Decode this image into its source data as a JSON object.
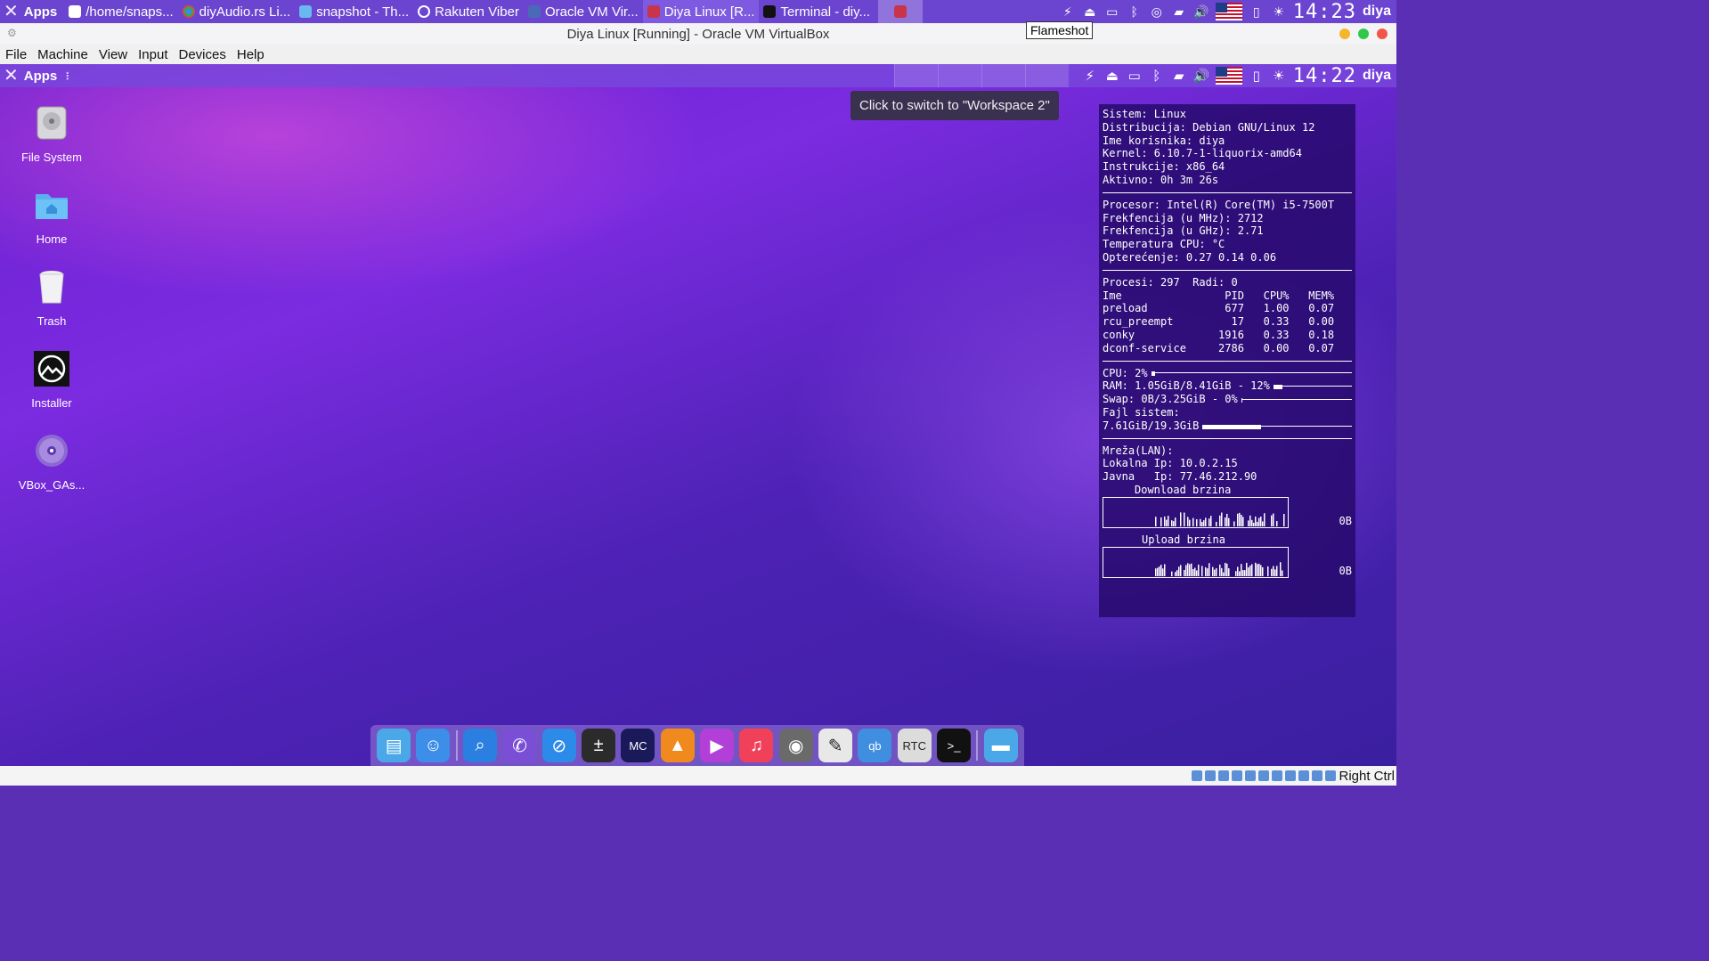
{
  "host_panel": {
    "apps_label": "Apps",
    "tasks": [
      {
        "label": "/home/snaps...",
        "icon": "text-editor-icon"
      },
      {
        "label": "diyAudio.rs Li...",
        "icon": "chrome-icon"
      },
      {
        "label": "snapshot - Th...",
        "icon": "file-manager-icon"
      },
      {
        "label": "Rakuten Viber",
        "icon": "viber-icon"
      },
      {
        "label": "Oracle VM Vir...",
        "icon": "virtualbox-icon"
      },
      {
        "label": "Diya Linux [R...",
        "icon": "vm-icon"
      },
      {
        "label": "Terminal - diy...",
        "icon": "terminal-icon"
      }
    ],
    "clock": "14:23",
    "user": "diya",
    "tooltip": "Flameshot"
  },
  "window": {
    "title": "Diya Linux [Running] - Oracle VM VirtualBox"
  },
  "menubar": [
    "File",
    "Machine",
    "View",
    "Input",
    "Devices",
    "Help"
  ],
  "guest_panel": {
    "apps_label": "Apps",
    "clock": "14:22",
    "user": "diya",
    "workspace_tooltip": "Click to switch to \"Workspace 2\""
  },
  "desktop_icons": [
    {
      "label": "File System",
      "icon": "drive-icon"
    },
    {
      "label": "Home",
      "icon": "home-folder-icon"
    },
    {
      "label": "Trash",
      "icon": "trash-icon"
    },
    {
      "label": "Installer",
      "icon": "installer-icon"
    },
    {
      "label": "VBox_GAs...",
      "icon": "cd-icon"
    }
  ],
  "conky": {
    "system": [
      "Sistem: Linux",
      "Distribucija: Debian GNU/Linux 12",
      "Ime korisnika: diya",
      "Kernel: 6.10.7-1-liquorix-amd64",
      "Instrukcije: x86_64",
      "Aktivno: 0h 3m 26s"
    ],
    "cpu": [
      "Procesor: Intel(R) Core(TM) i5-7500T",
      "Frekfencija (u MHz): 2712",
      "Frekfencija (u GHz): 2.71",
      "Temperatura CPU: °C",
      "Opterećenje: 0.27 0.14 0.06"
    ],
    "procs_line": "Procesi: 297  Radi: 0",
    "proc_header": "Ime                PID   CPU%   MEM%",
    "procs": [
      "preload            677   1.00   0.07",
      "rcu_preempt         17   0.33   0.00",
      "conky             1916   0.33   0.18",
      "dconf-service     2786   0.00   0.07"
    ],
    "cpu_usage": "CPU: 2%",
    "cpu_fraction": 0.02,
    "ram_usage": "RAM: 1.05GiB/8.41GiB - 12%",
    "ram_fraction": 0.12,
    "swap_usage": "Swap: 0B/3.25GiB - 0%",
    "swap_fraction": 0.0,
    "fs_label": "Fajl sistem:",
    "fs_usage": "7.61GiB/19.3GiB",
    "fs_fraction": 0.39,
    "net_title": "Mreža(LAN):",
    "local_ip": "Lokalna Ip: 10.0.2.15",
    "public_ip": "Javna   Ip: 77.46.212.90",
    "download_label": "Download brzina",
    "download_value": "0B",
    "upload_label": "Upload brzina",
    "upload_value": "0B"
  },
  "dock": [
    {
      "name": "files-icon",
      "color": "#4aa8e8"
    },
    {
      "name": "finder-icon",
      "color": "#3c8ee8"
    },
    {
      "name": "search-icon",
      "color": "#2a7fe0"
    },
    {
      "name": "viber-icon",
      "color": "#7a4fd6"
    },
    {
      "name": "safari-icon",
      "color": "#2c8ae8"
    },
    {
      "name": "calculator-icon",
      "color": "#2b2b2b"
    },
    {
      "name": "midnight-commander-icon",
      "color": "#1a1a5a"
    },
    {
      "name": "vlc-icon",
      "color": "#f08a1e"
    },
    {
      "name": "media-player-icon",
      "color": "#b23fd8"
    },
    {
      "name": "music-icon",
      "color": "#f0405a"
    },
    {
      "name": "ipod-icon",
      "color": "#6a6a6a"
    },
    {
      "name": "text-editor-icon",
      "color": "#e8e8e8"
    },
    {
      "name": "qbittorrent-icon",
      "color": "#3f8ee0"
    },
    {
      "name": "rtc-qs-icon",
      "color": "#dcdcdc"
    },
    {
      "name": "terminal-icon",
      "color": "#111111"
    },
    {
      "name": "folder-icon",
      "color": "#4aa8e8"
    }
  ],
  "statusbar": {
    "host_key": "Right Ctrl"
  }
}
